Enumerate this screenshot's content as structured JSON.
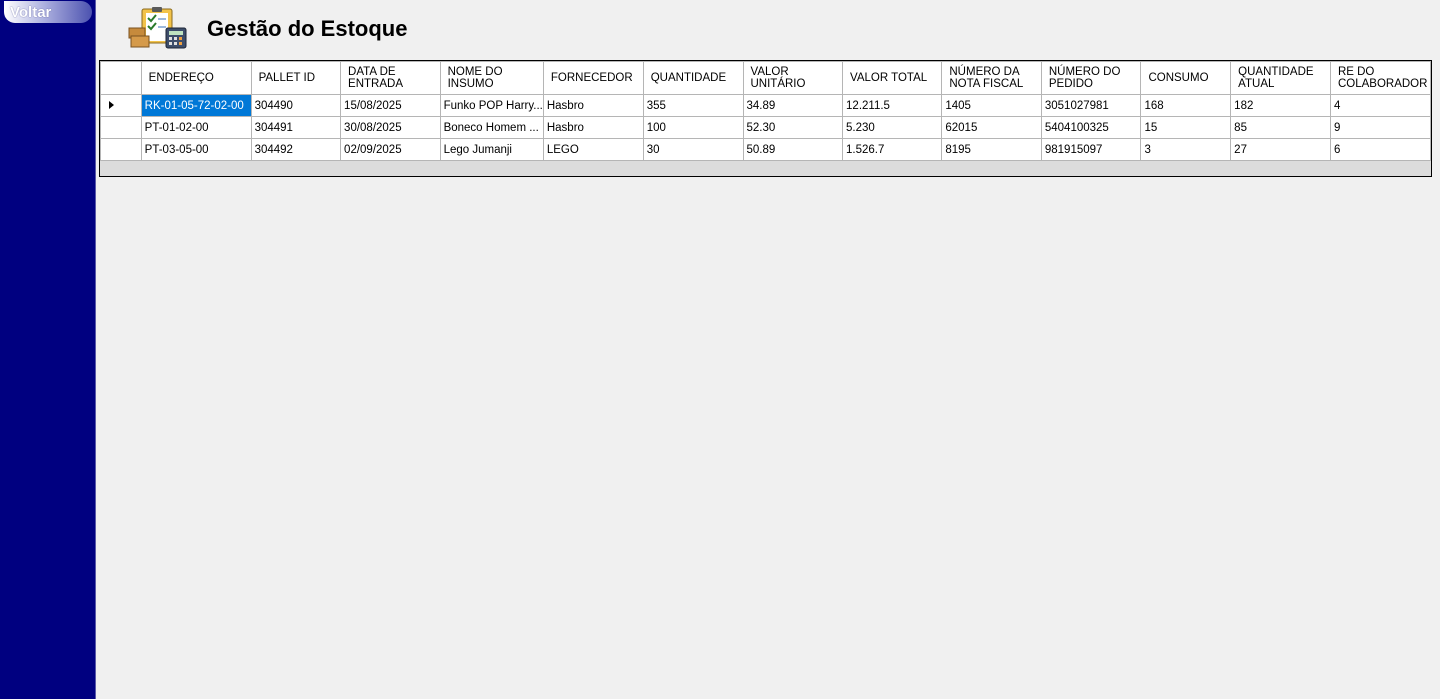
{
  "sidebar": {
    "back_label": "Voltar"
  },
  "header": {
    "title": "Gestão do Estoque",
    "logo_icon": "inventory-clipboard-calculator-icon"
  },
  "table": {
    "columns": [
      "ENDEREÇO",
      "PALLET ID",
      "DATA DE ENTRADA",
      "NOME DO INSUMO",
      "FORNECEDOR",
      "QUANTIDADE",
      "VALOR UNITÁRIO",
      "VALOR TOTAL",
      "NÚMERO DA NOTA FISCAL",
      "NÚMERO DO PEDIDO",
      "CONSUMO",
      "QUANTIDADE ATUAL",
      "RE DO COLABORADOR"
    ],
    "rows": [
      [
        "RK-01-05-72-02-00",
        "304490",
        "15/08/2025",
        "Funko POP Harry...",
        "Hasbro",
        "355",
        "34.89",
        "12.211.5",
        "1405",
        "3051027981",
        "168",
        "182",
        "4"
      ],
      [
        "PT-01-02-00",
        "304491",
        "30/08/2025",
        "Boneco Homem ...",
        "Hasbro",
        "100",
        "52.30",
        "5.230",
        "62015",
        "5404100325",
        "15",
        "85",
        "9"
      ],
      [
        "PT-03-05-00",
        "304492",
        "02/09/2025",
        "Lego Jumanji",
        "LEGO",
        "30",
        "50.89",
        "1.526.7",
        "8195",
        "981915097",
        "3",
        "27",
        "6"
      ]
    ]
  },
  "colors": {
    "sidebar": "#000080",
    "selection": "#0078d7",
    "background": "#f0f0f0"
  }
}
